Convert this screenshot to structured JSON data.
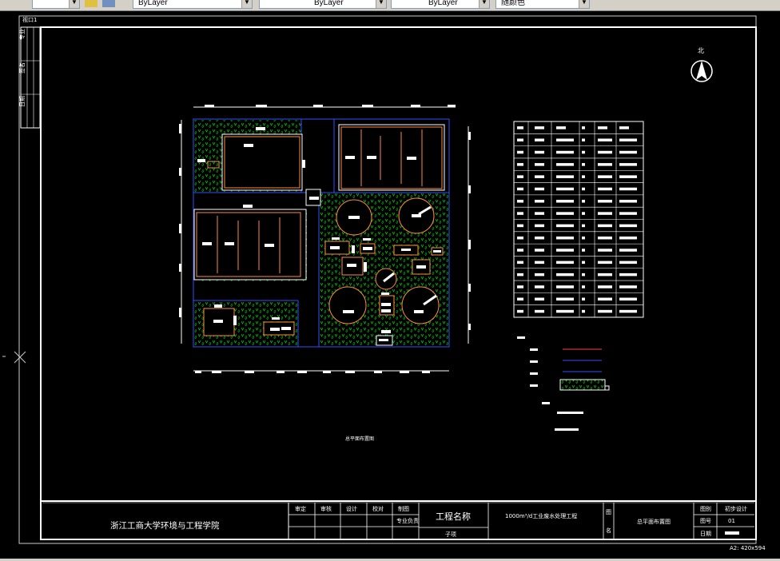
{
  "toolbar": {
    "layer_color": "ByLayer",
    "linetype": "ByLayer",
    "lineweight": "ByLayer",
    "plot_style": "随颜色"
  },
  "drawing": {
    "viewport_label": "视口1",
    "north_label": "北",
    "plan_caption": "总平面布置图",
    "scale_note": "A2: 420x594",
    "colors": {
      "background": "#000000",
      "frame": "#ffffff",
      "grass": "#00ff00",
      "pipe_red": "#ff4040",
      "pipe_blue": "#3050ff",
      "tank": "#ff8c3a"
    }
  },
  "title_block": {
    "institution": "浙江工商大学环境与工程学院",
    "roles": [
      "审定",
      "审核",
      "设计",
      "校对",
      "制图"
    ],
    "sub_role": "专业负责",
    "project_label": "工程名称",
    "project_sub": "子项",
    "project_name": "1000m³/d工业废水处理工程",
    "drawing_label_1": "图",
    "drawing_label_2": "名",
    "drawing_name": "总平面布置图",
    "rows": [
      {
        "label": "图别",
        "value": "初步设计"
      },
      {
        "label": "图号",
        "value": "01"
      },
      {
        "label": "日期",
        "value": ""
      }
    ]
  },
  "sidebar_stamp": {
    "labels": [
      "专业",
      "签名",
      "日期"
    ]
  },
  "legend_table": {
    "rows": 16,
    "cols": 7
  }
}
